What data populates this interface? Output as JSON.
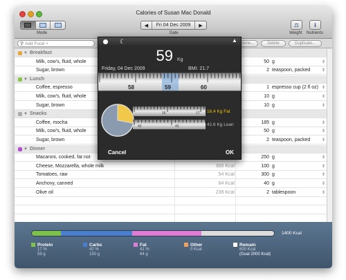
{
  "window": {
    "title": "Calories of Susan Mac Donald"
  },
  "toolbar": {
    "mode_label": "Mode",
    "date_label": "Date",
    "date_value": "Fri 04 Dec 2009",
    "prev": "◀",
    "next": "▶",
    "weight_label": "Weight",
    "nutrients_label": "Nutrients"
  },
  "search": {
    "placeholder": "Add Food +"
  },
  "actions": {
    "combine": "Combine...",
    "delete": "Delete",
    "duplicate": "Duplicate..."
  },
  "rows": [
    {
      "type": "group",
      "name": "Breakfast",
      "dot": "#e6a640"
    },
    {
      "type": "item",
      "name": "Milk, cow's, fluid, whole",
      "kcal": "",
      "qty": "50",
      "unit": "g"
    },
    {
      "type": "item",
      "name": "Sugar, brown",
      "kcal": "",
      "qty": "2",
      "unit": "teaspoon, packed"
    },
    {
      "type": "group",
      "name": "Lunch",
      "dot": "#8bc34a"
    },
    {
      "type": "item",
      "name": "Coffee, espresso",
      "kcal": "",
      "qty": "1",
      "unit": "espresso cup (2 fl oz)"
    },
    {
      "type": "item",
      "name": "Milk, cow's, fluid, whole",
      "kcal": "",
      "qty": "10",
      "unit": "g"
    },
    {
      "type": "item",
      "name": "Sugar, brown",
      "kcal": "",
      "qty": "10",
      "unit": "g"
    },
    {
      "type": "group",
      "name": "Snacks",
      "dot": "#aaaaaa"
    },
    {
      "type": "item",
      "name": "Coffee, mocha",
      "kcal": "",
      "qty": "185",
      "unit": "g"
    },
    {
      "type": "item",
      "name": "Milk, cow's, fluid, whole",
      "kcal": "",
      "qty": "50",
      "unit": "g"
    },
    {
      "type": "item",
      "name": "Sugar, brown",
      "kcal": "",
      "qty": "2",
      "unit": "teaspoon, packed"
    },
    {
      "type": "group",
      "name": "Dinner",
      "dot": "#b44fd0"
    },
    {
      "type": "item",
      "name": "Macaroni, cooked, fat not",
      "kcal": "",
      "qty": "250",
      "unit": "g"
    },
    {
      "type": "item",
      "name": "Cheese, Mozzarella, whole milk",
      "kcal": "300 Kcal",
      "qty": "100",
      "unit": "g"
    },
    {
      "type": "item",
      "name": "Tomatoes, raw",
      "kcal": "54 Kcal",
      "qty": "300",
      "unit": "g"
    },
    {
      "type": "item",
      "name": "Anchovy, canned",
      "kcal": "84 Kcal",
      "qty": "40",
      "unit": "g"
    },
    {
      "type": "item",
      "name": "Olive oil",
      "kcal": "239 Kcal",
      "qty": "2",
      "unit": "tablespoon"
    }
  ],
  "summary": {
    "total": "1400 Kcal",
    "protein": {
      "label": "Protein",
      "pct": "17 %",
      "grams": "59 g",
      "color": "#7fc24a",
      "share": 0.17
    },
    "carbs": {
      "label": "Carbs",
      "pct": "42 %",
      "grams": "150 g",
      "color": "#4a7fd0",
      "share": 0.42
    },
    "fat": {
      "label": "Fat",
      "pct": "41 %",
      "grams": "64 g",
      "color": "#e07bd6",
      "share": 0.41
    },
    "other": {
      "label": "Other",
      "value": "0 Kcal",
      "color": "#f0a060"
    },
    "remain": {
      "label": "Remain",
      "value": "600 Kcal",
      "goal": "(Goal 2000 Kcal)",
      "color": "#ffffff"
    }
  },
  "weight_panel": {
    "weight": "59",
    "unit": "Kg",
    "date": "Friday, 04 Dec 2009",
    "bmi": "BMI: 21.7",
    "ruler_labels": [
      "58",
      "59",
      "60"
    ],
    "fat_ruler_labels": [
      "16",
      "17"
    ],
    "lean_ruler_labels": [
      "42",
      "43"
    ],
    "fat": "16.4 Kg Fat",
    "lean": "42.6 Kg Lean",
    "fat_share": 0.28,
    "cancel": "Cancel",
    "ok": "OK"
  }
}
